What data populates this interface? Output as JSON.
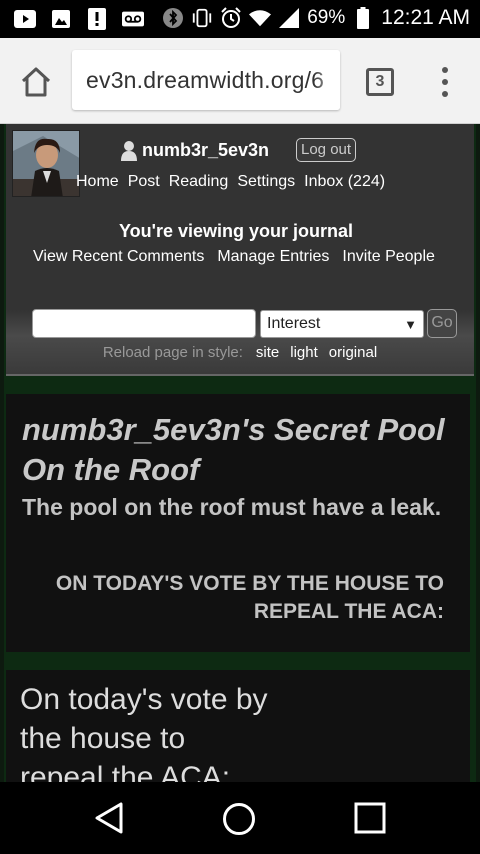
{
  "status_bar": {
    "battery": "69%",
    "time": "12:21 AM"
  },
  "browser": {
    "url": "ev3n.dreamwidth.org/6",
    "tab_count": "3"
  },
  "site_nav": {
    "username": "numb3r_5ev3n",
    "logout_label": "Log out",
    "links": [
      "Home",
      "Post",
      "Reading",
      "Settings",
      "Inbox (224)"
    ],
    "viewing_message": "You're viewing your journal",
    "sub_links": [
      "View Recent Comments",
      "Manage Entries",
      "Invite People"
    ],
    "search": {
      "value": "",
      "select_value": "Interest",
      "go_label": "Go"
    },
    "style_switch": {
      "label": "Reload page in style:",
      "options": [
        "site",
        "light",
        "original"
      ]
    }
  },
  "journal": {
    "title": "numb3r_5ev3n's Secret Pool On the Roof",
    "subtitle": "The pool on the roof must have a leak.",
    "entry_subject": "ON TODAY'S VOTE BY THE HOUSE TO REPEAL THE ACA:",
    "entry_text": "On today's vote by the house to repeal the ACA:"
  }
}
